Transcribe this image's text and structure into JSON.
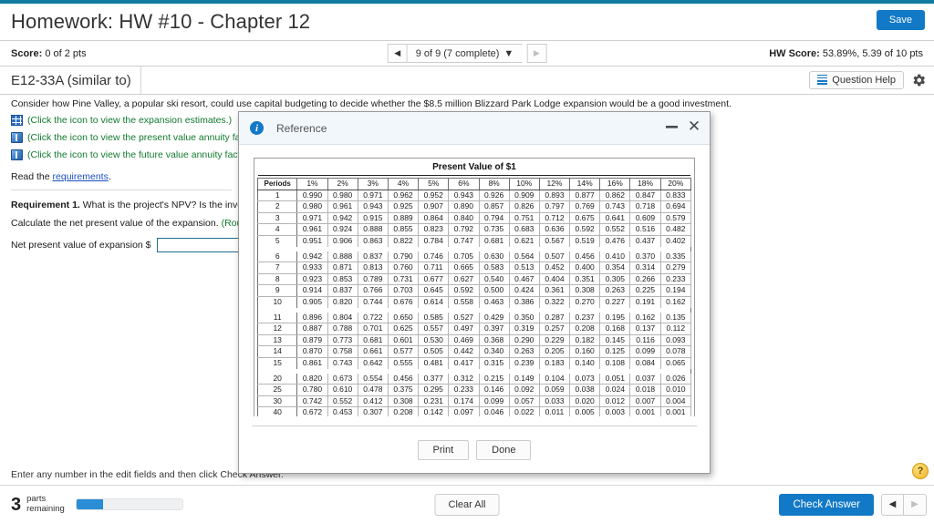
{
  "header": {
    "title": "Homework: HW #10 - Chapter 12",
    "save_label": "Save"
  },
  "scorebar": {
    "score_label": "Score:",
    "score_value": "0 of 2 pts",
    "pager_prev_icon": "◀",
    "pager_next_icon": "▶",
    "pager_text": "9 of 9 (7 complete)",
    "pager_caret": "▼",
    "hw_score_label": "HW Score:",
    "hw_score_value": "53.89%, 5.39 of 10 pts"
  },
  "exercise": {
    "id_label": "E12-33A (similar to)",
    "question_help_label": "Question Help",
    "gear_icon": "gear-icon"
  },
  "problem": {
    "intro": "Consider how Pine Valley, a popular ski resort, could use capital budgeting to decide whether the $8.5 million Blizzard Park Lodge expansion would be a good investment.",
    "links": [
      {
        "icon": "table-grid-icon",
        "text": "(Click the icon to view the expansion estimates.)"
      },
      {
        "icon": "book-icon",
        "text": "(Click the icon to view the present value annuity factor table.)"
      },
      {
        "icon": "book-icon",
        "text": "(Click the icon to view the future value annuity factor table.)"
      }
    ],
    "read_prefix": "Read the ",
    "read_link": "requirements",
    "read_suffix": ".",
    "requirement_label": "Requirement 1.",
    "requirement_text": " What is the project's NPV? Is the investment attractive? Why?",
    "calc_text": "Calculate the net present value of the expansion. ",
    "calc_hint": "(Round your answer to the nearest whole dollar.)",
    "answer_label": "Net present value of expansion $",
    "answer_value": "",
    "answer_placeholder": ""
  },
  "modal": {
    "title": "Reference",
    "info_icon": "info-icon",
    "minimize_icon": "▬",
    "close_icon": "✕",
    "table_title": "Present Value of $1",
    "print_label": "Print",
    "done_label": "Done"
  },
  "chart_data": {
    "type": "table",
    "title": "Present Value of $1",
    "columns": [
      "Periods",
      "1%",
      "2%",
      "3%",
      "4%",
      "5%",
      "6%",
      "8%",
      "10%",
      "12%",
      "14%",
      "16%",
      "18%",
      "20%"
    ],
    "row_groups": [
      [
        [
          "1",
          "0.990",
          "0.980",
          "0.971",
          "0.962",
          "0.952",
          "0.943",
          "0.926",
          "0.909",
          "0.893",
          "0.877",
          "0.862",
          "0.847",
          "0.833"
        ],
        [
          "2",
          "0.980",
          "0.961",
          "0.943",
          "0.925",
          "0.907",
          "0.890",
          "0.857",
          "0.826",
          "0.797",
          "0.769",
          "0.743",
          "0.718",
          "0.694"
        ],
        [
          "3",
          "0.971",
          "0.942",
          "0.915",
          "0.889",
          "0.864",
          "0.840",
          "0.794",
          "0.751",
          "0.712",
          "0.675",
          "0.641",
          "0.609",
          "0.579"
        ],
        [
          "4",
          "0.961",
          "0.924",
          "0.888",
          "0.855",
          "0.823",
          "0.792",
          "0.735",
          "0.683",
          "0.636",
          "0.592",
          "0.552",
          "0.516",
          "0.482"
        ],
        [
          "5",
          "0.951",
          "0.906",
          "0.863",
          "0.822",
          "0.784",
          "0.747",
          "0.681",
          "0.621",
          "0.567",
          "0.519",
          "0.476",
          "0.437",
          "0.402"
        ]
      ],
      [
        [
          "6",
          "0.942",
          "0.888",
          "0.837",
          "0.790",
          "0.746",
          "0.705",
          "0.630",
          "0.564",
          "0.507",
          "0.456",
          "0.410",
          "0.370",
          "0.335"
        ],
        [
          "7",
          "0.933",
          "0.871",
          "0.813",
          "0.760",
          "0.711",
          "0.665",
          "0.583",
          "0.513",
          "0.452",
          "0.400",
          "0.354",
          "0.314",
          "0.279"
        ],
        [
          "8",
          "0.923",
          "0.853",
          "0.789",
          "0.731",
          "0.677",
          "0.627",
          "0.540",
          "0.467",
          "0.404",
          "0.351",
          "0.305",
          "0.266",
          "0.233"
        ],
        [
          "9",
          "0.914",
          "0.837",
          "0.766",
          "0.703",
          "0.645",
          "0.592",
          "0.500",
          "0.424",
          "0.361",
          "0.308",
          "0.263",
          "0.225",
          "0.194"
        ],
        [
          "10",
          "0.905",
          "0.820",
          "0.744",
          "0.676",
          "0.614",
          "0.558",
          "0.463",
          "0.386",
          "0.322",
          "0.270",
          "0.227",
          "0.191",
          "0.162"
        ]
      ],
      [
        [
          "11",
          "0.896",
          "0.804",
          "0.722",
          "0.650",
          "0.585",
          "0.527",
          "0.429",
          "0.350",
          "0.287",
          "0.237",
          "0.195",
          "0.162",
          "0.135"
        ],
        [
          "12",
          "0.887",
          "0.788",
          "0.701",
          "0.625",
          "0.557",
          "0.497",
          "0.397",
          "0.319",
          "0.257",
          "0.208",
          "0.168",
          "0.137",
          "0.112"
        ],
        [
          "13",
          "0.879",
          "0.773",
          "0.681",
          "0.601",
          "0.530",
          "0.469",
          "0.368",
          "0.290",
          "0.229",
          "0.182",
          "0.145",
          "0.116",
          "0.093"
        ],
        [
          "14",
          "0.870",
          "0.758",
          "0.661",
          "0.577",
          "0.505",
          "0.442",
          "0.340",
          "0.263",
          "0.205",
          "0.160",
          "0.125",
          "0.099",
          "0.078"
        ],
        [
          "15",
          "0.861",
          "0.743",
          "0.642",
          "0.555",
          "0.481",
          "0.417",
          "0.315",
          "0.239",
          "0.183",
          "0.140",
          "0.108",
          "0.084",
          "0.065"
        ]
      ],
      [
        [
          "20",
          "0.820",
          "0.673",
          "0.554",
          "0.456",
          "0.377",
          "0.312",
          "0.215",
          "0.149",
          "0.104",
          "0.073",
          "0.051",
          "0.037",
          "0.026"
        ],
        [
          "25",
          "0.780",
          "0.610",
          "0.478",
          "0.375",
          "0.295",
          "0.233",
          "0.146",
          "0.092",
          "0.059",
          "0.038",
          "0.024",
          "0.018",
          "0.010"
        ],
        [
          "30",
          "0.742",
          "0.552",
          "0.412",
          "0.308",
          "0.231",
          "0.174",
          "0.099",
          "0.057",
          "0.033",
          "0.020",
          "0.012",
          "0.007",
          "0.004"
        ],
        [
          "40",
          "0.672",
          "0.453",
          "0.307",
          "0.208",
          "0.142",
          "0.097",
          "0.046",
          "0.022",
          "0.011",
          "0.005",
          "0.003",
          "0.001",
          "0.001"
        ]
      ]
    ]
  },
  "footer": {
    "note": "Enter any number in the edit fields and then click Check Answer.",
    "parts_count": "3",
    "parts_label_line1": "parts",
    "parts_label_line2": "remaining",
    "progress_percent": 25,
    "clear_all_label": "Clear All",
    "check_answer_label": "Check Answer",
    "prev_icon": "◀",
    "next_icon": "▶",
    "help_icon": "?"
  },
  "colors": {
    "accent": "#1279c6",
    "topbar": "#0f7b9c",
    "link_green": "#127a2e",
    "link_blue": "#1a4fbf"
  }
}
